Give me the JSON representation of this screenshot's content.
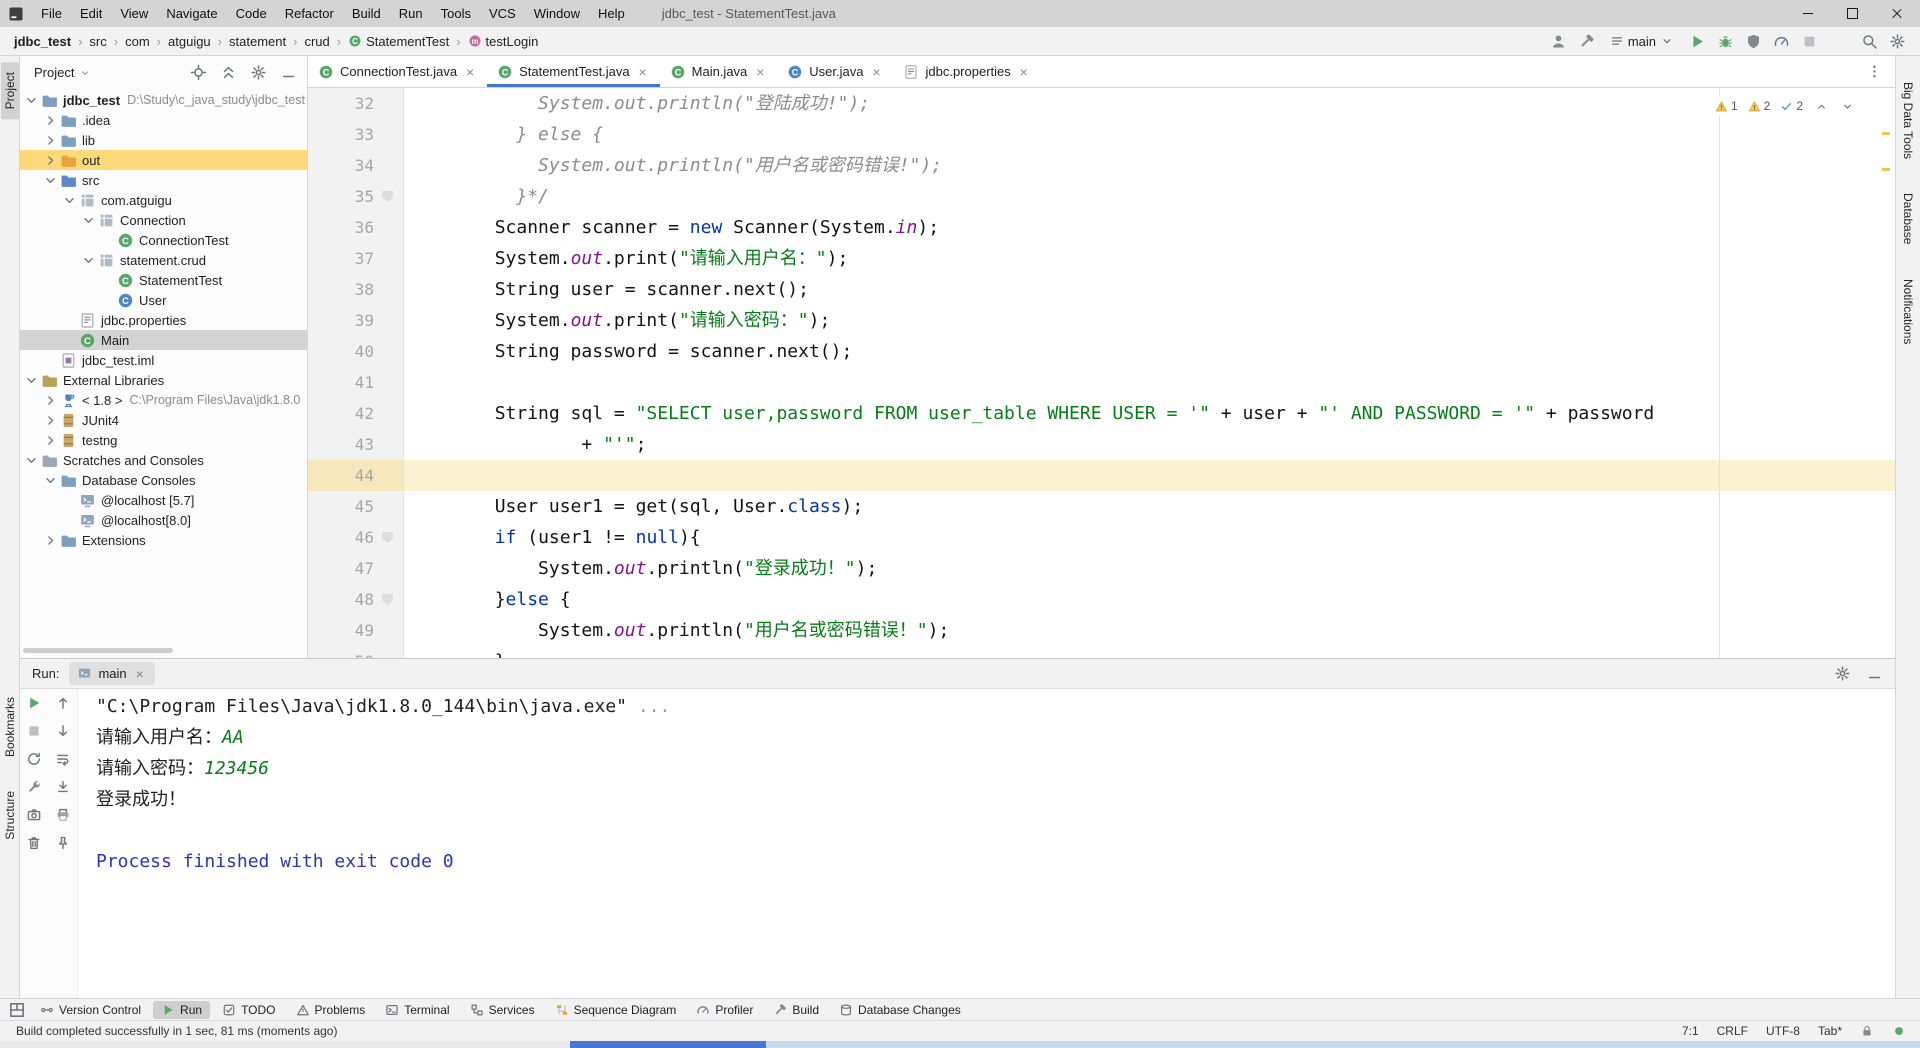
{
  "titlebar": {
    "icon": "idea-logo",
    "menus": [
      "File",
      "Edit",
      "View",
      "Navigate",
      "Code",
      "Refactor",
      "Build",
      "Run",
      "Tools",
      "VCS",
      "Window",
      "Help"
    ],
    "title": "jdbc_test - StatementTest.java"
  },
  "navbar": {
    "breadcrumbs": [
      {
        "label": "jdbc_test",
        "bold": true
      },
      {
        "label": "src"
      },
      {
        "label": "com"
      },
      {
        "label": "atguigu"
      },
      {
        "label": "statement"
      },
      {
        "label": "crud"
      },
      {
        "label": "StatementTest",
        "icon": "class-run"
      },
      {
        "label": "testLogin",
        "icon": "method"
      }
    ],
    "pre_icons": [
      "user",
      "hammer"
    ],
    "branch": "main",
    "run_icons": [
      "run",
      "debug",
      "coverage",
      "profiler",
      "stop"
    ],
    "tail_icons": [
      "search",
      "settings"
    ]
  },
  "stripes": {
    "left_top": [
      {
        "label": "Project",
        "active": true
      }
    ],
    "left_bottom": [
      {
        "label": "Bookmarks"
      },
      {
        "label": "Structure"
      }
    ],
    "right": [
      {
        "label": "Big Data Tools"
      },
      {
        "label": "Database"
      },
      {
        "label": "Notifications"
      }
    ]
  },
  "project": {
    "header": {
      "title": "Project",
      "caret_icon": "caret-down",
      "icons": [
        "locate",
        "collapse",
        "settings",
        "hide"
      ]
    },
    "tree": [
      {
        "d": 0,
        "c": "v",
        "i": "folder",
        "l": "jdbc_test",
        "x": "D:\\Study\\c_java_study\\jdbc_test",
        "b": true
      },
      {
        "d": 1,
        "c": ">",
        "i": "folder",
        "l": ".idea"
      },
      {
        "d": 1,
        "c": ">",
        "i": "folder",
        "l": "lib"
      },
      {
        "d": 1,
        "c": ">",
        "i": "folder-out",
        "l": "out",
        "hl": true
      },
      {
        "d": 1,
        "c": "v",
        "i": "folder-src",
        "l": "src"
      },
      {
        "d": 2,
        "c": "v",
        "i": "package",
        "l": "com.atguigu"
      },
      {
        "d": 3,
        "c": "v",
        "i": "package",
        "l": "Connection"
      },
      {
        "d": 4,
        "c": "",
        "i": "class-run",
        "l": "ConnectionTest"
      },
      {
        "d": 3,
        "c": "v",
        "i": "package",
        "l": "statement.crud"
      },
      {
        "d": 4,
        "c": "",
        "i": "class-run",
        "l": "StatementTest"
      },
      {
        "d": 4,
        "c": "",
        "i": "class",
        "l": "User"
      },
      {
        "d": 2,
        "c": "",
        "i": "properties",
        "l": "jdbc.properties"
      },
      {
        "d": 2,
        "c": "",
        "i": "class-run",
        "l": "Main",
        "sel": true
      },
      {
        "d": 1,
        "c": "",
        "i": "iml",
        "l": "jdbc_test.iml"
      },
      {
        "d": 0,
        "c": "v",
        "i": "folder-libs",
        "l": "External Libraries"
      },
      {
        "d": 1,
        "c": ">",
        "i": "jdk",
        "l": "< 1.8 >",
        "x": "C:\\Program Files\\Java\\jdk1.8.0"
      },
      {
        "d": 1,
        "c": ">",
        "i": "jar",
        "l": "JUnit4"
      },
      {
        "d": 1,
        "c": ">",
        "i": "jar",
        "l": "testng"
      },
      {
        "d": 0,
        "c": "v",
        "i": "folder-scratch",
        "l": "Scratches and Consoles"
      },
      {
        "d": 1,
        "c": "v",
        "i": "folder",
        "l": "Database Consoles"
      },
      {
        "d": 2,
        "c": "",
        "i": "db-console",
        "l": "@localhost [5.7]"
      },
      {
        "d": 2,
        "c": "",
        "i": "db-console",
        "l": "@localhost[8.0]"
      },
      {
        "d": 1,
        "c": ">",
        "i": "folder",
        "l": "Extensions"
      }
    ]
  },
  "editor": {
    "tabs": [
      {
        "label": "ConnectionTest.java",
        "icon": "class-run"
      },
      {
        "label": "StatementTest.java",
        "icon": "class-run",
        "active": true
      },
      {
        "label": "Main.java",
        "icon": "class-run"
      },
      {
        "label": "User.java",
        "icon": "class"
      },
      {
        "label": "jdbc.properties",
        "icon": "properties"
      }
    ],
    "inspections": [
      [
        "warning",
        "1"
      ],
      [
        "warning",
        "2"
      ],
      [
        "check",
        "2"
      ]
    ],
    "lines": [
      {
        "n": 32,
        "t": [
          [
            "c",
            "            System.out.println(\"登陆成功!\");"
          ]
        ]
      },
      {
        "n": 33,
        "t": [
          [
            "c",
            "          } else {"
          ]
        ]
      },
      {
        "n": 34,
        "t": [
          [
            "c",
            "            System.out.println(\"用户名或密码错误!\");"
          ]
        ]
      },
      {
        "n": 35,
        "fold": true,
        "t": [
          [
            "c",
            "          }*/"
          ]
        ]
      },
      {
        "n": 36,
        "t": [
          [
            "p",
            "        Scanner scanner = "
          ],
          [
            "k",
            "new"
          ],
          [
            "p",
            " Scanner(System."
          ],
          [
            "f",
            "in"
          ],
          [
            "p",
            ");"
          ]
        ]
      },
      {
        "n": 37,
        "t": [
          [
            "p",
            "        System."
          ],
          [
            "f",
            "out"
          ],
          [
            "p",
            ".print("
          ],
          [
            "s",
            "\"请输入用户名：\""
          ],
          [
            "p",
            ");"
          ]
        ]
      },
      {
        "n": 38,
        "t": [
          [
            "p",
            "        String user = scanner.next();"
          ]
        ]
      },
      {
        "n": 39,
        "t": [
          [
            "p",
            "        System."
          ],
          [
            "f",
            "out"
          ],
          [
            "p",
            ".print("
          ],
          [
            "s",
            "\"请输入密码：\""
          ],
          [
            "p",
            ");"
          ]
        ]
      },
      {
        "n": 40,
        "t": [
          [
            "p",
            "        String password = scanner.next();"
          ]
        ]
      },
      {
        "n": 41,
        "t": []
      },
      {
        "n": 42,
        "t": [
          [
            "p",
            "        String sql = "
          ],
          [
            "s",
            "\"SELECT user,password FROM user_table WHERE USER = '\""
          ],
          [
            "p",
            " + user + "
          ],
          [
            "s",
            "\"' AND PASSWORD = '\""
          ],
          [
            "p",
            " + password"
          ]
        ]
      },
      {
        "n": 43,
        "t": [
          [
            "p",
            "                + "
          ],
          [
            "s",
            "\"'\""
          ],
          [
            "p",
            ";"
          ]
        ]
      },
      {
        "n": 44,
        "caret": true,
        "t": []
      },
      {
        "n": 45,
        "t": [
          [
            "p",
            "        User user1 = get(sql, User."
          ],
          [
            "k",
            "class"
          ],
          [
            "p",
            ");"
          ]
        ]
      },
      {
        "n": 46,
        "fold": true,
        "t": [
          [
            "p",
            "        "
          ],
          [
            "k",
            "if"
          ],
          [
            "p",
            " (user1 != "
          ],
          [
            "k",
            "null"
          ],
          [
            "p",
            "){"
          ]
        ]
      },
      {
        "n": 47,
        "t": [
          [
            "p",
            "            System."
          ],
          [
            "f",
            "out"
          ],
          [
            "p",
            ".println("
          ],
          [
            "s",
            "\"登录成功！\""
          ],
          [
            "p",
            ");"
          ]
        ]
      },
      {
        "n": 48,
        "fold": true,
        "t": [
          [
            "p",
            "        }"
          ],
          [
            "k",
            "else"
          ],
          [
            "p",
            " {"
          ]
        ]
      },
      {
        "n": 49,
        "t": [
          [
            "p",
            "            System."
          ],
          [
            "f",
            "out"
          ],
          [
            "p",
            ".println("
          ],
          [
            "s",
            "\"用户名或密码错误！\""
          ],
          [
            "p",
            ");"
          ]
        ]
      },
      {
        "n": 50,
        "t": [
          [
            "p",
            "        }"
          ]
        ]
      }
    ]
  },
  "run": {
    "label": "Run:",
    "tab": {
      "label": "main",
      "icon": "console"
    },
    "header_icons": [
      "settings",
      "hide"
    ],
    "toolbar_col1": [
      "rerun",
      "stop",
      "restore-layout",
      "run-settings",
      "dump-threads",
      "clear"
    ],
    "toolbar_col2": [
      "up-stack",
      "down-stack",
      "soft-wrap",
      "scroll-to-end",
      "print",
      "pin"
    ],
    "console": [
      {
        "parts": [
          [
            "plain",
            "\"C:\\Program Files\\Java\\jdk1.8.0_144\\bin\\java.exe\" "
          ],
          [
            "dim",
            "..."
          ]
        ]
      },
      {
        "parts": [
          [
            "plain",
            "请输入用户名："
          ],
          [
            "input",
            "AA"
          ]
        ]
      },
      {
        "parts": [
          [
            "plain",
            "请输入密码："
          ],
          [
            "input",
            "123456"
          ]
        ]
      },
      {
        "parts": [
          [
            "plain",
            "登录成功！"
          ]
        ]
      },
      {
        "parts": []
      },
      {
        "parts": [
          [
            "sys",
            "Process finished with exit code 0"
          ]
        ]
      }
    ]
  },
  "bottombar": {
    "switcher_icon": "switcher",
    "items": [
      {
        "label": "Version Control",
        "icon": "vcs"
      },
      {
        "label": "Run",
        "icon": "run",
        "active": true
      },
      {
        "label": "TODO",
        "icon": "todo"
      },
      {
        "label": "Problems",
        "icon": "problems"
      },
      {
        "label": "Terminal",
        "icon": "terminal"
      },
      {
        "label": "Services",
        "icon": "services"
      },
      {
        "label": "Sequence Diagram",
        "icon": "sequence"
      },
      {
        "label": "Profiler",
        "icon": "profiler"
      },
      {
        "label": "Build",
        "icon": "build"
      },
      {
        "label": "Database Changes",
        "icon": "database"
      }
    ]
  },
  "statusbar": {
    "message": "Build completed successfully in 1 sec, 81 ms (moments ago)",
    "right": [
      {
        "t": "text",
        "v": "7:1",
        "n": "caret-position"
      },
      {
        "t": "text",
        "v": "CRLF",
        "n": "line-separator"
      },
      {
        "t": "text",
        "v": "UTF-8",
        "n": "file-encoding"
      },
      {
        "t": "text",
        "v": "Tab*",
        "n": "indent-style"
      },
      {
        "t": "icon",
        "v": "lock",
        "n": "write-access-lock"
      },
      {
        "t": "icon",
        "v": "green-dot",
        "n": "ide-status"
      }
    ]
  }
}
